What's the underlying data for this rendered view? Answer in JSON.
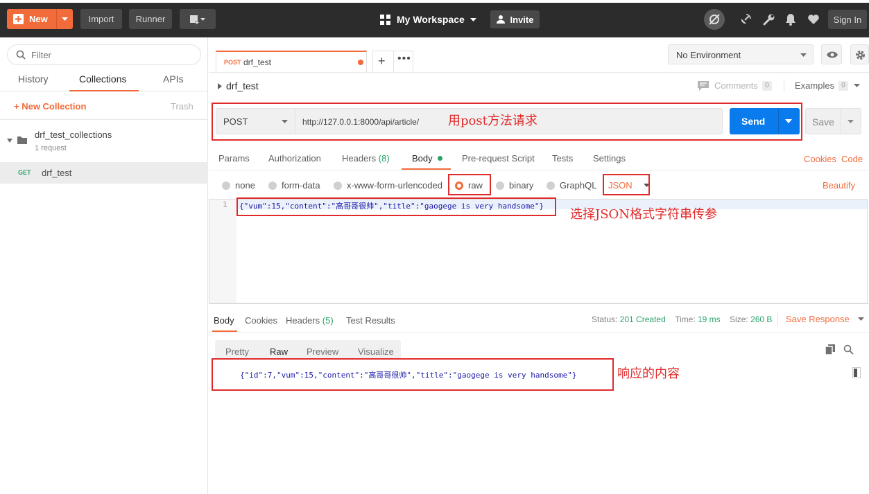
{
  "topbar": {
    "new_label": "New",
    "import_label": "Import",
    "runner_label": "Runner",
    "workspace_label": "My Workspace",
    "invite_label": "Invite",
    "signin_label": "Sign In"
  },
  "sidebar": {
    "filter_placeholder": "Filter",
    "tabs": [
      {
        "label": "History"
      },
      {
        "label": "Collections"
      },
      {
        "label": "APIs"
      }
    ],
    "new_collection_label": "+ New Collection",
    "trash_label": "Trash",
    "collection": {
      "name": "drf_test_collections",
      "meta": "1 request"
    },
    "request": {
      "method": "GET",
      "name": "drf_test"
    }
  },
  "tab": {
    "method": "POST",
    "name": "drf_test"
  },
  "environment": {
    "selected": "No Environment"
  },
  "breadcrumb": "drf_test",
  "comments": {
    "label": "Comments",
    "count": "0"
  },
  "examples": {
    "label": "Examples",
    "count": "0"
  },
  "request": {
    "method": "POST",
    "url": "http://127.0.0.1:8000/api/article/",
    "send_label": "Send",
    "save_label": "Save",
    "tabs": {
      "params": "Params",
      "authorization": "Authorization",
      "headers": "Headers",
      "headers_count": "(8)",
      "body": "Body",
      "prerequest": "Pre-request Script",
      "tests": "Tests",
      "settings": "Settings"
    },
    "cookies_label": "Cookies",
    "code_label": "Code",
    "body_types": {
      "none": "none",
      "form_data": "form-data",
      "urlencoded": "x-www-form-urlencoded",
      "raw": "raw",
      "binary": "binary",
      "graphql": "GraphQL"
    },
    "format": "JSON",
    "beautify_label": "Beautify",
    "line_number": "1",
    "body": "{\"vum\":15,\"content\":\"高哥哥很帅\",\"title\":\"gaogege is very handsome\"}"
  },
  "response": {
    "tabs": {
      "body": "Body",
      "cookies": "Cookies",
      "headers": "Headers",
      "headers_count": "(5)",
      "test_results": "Test Results"
    },
    "status_label": "Status:",
    "status_value": "201 Created",
    "time_label": "Time:",
    "time_value": "19 ms",
    "size_label": "Size:",
    "size_value": "260 B",
    "save_response_label": "Save Response",
    "view_tabs": {
      "pretty": "Pretty",
      "raw": "Raw",
      "preview": "Preview",
      "visualize": "Visualize"
    },
    "body": "{\"id\":7,\"vum\":15,\"content\":\"高哥哥很帅\",\"title\":\"gaogege is very handsome\"}"
  },
  "annotations": {
    "post_note": "用post方法请求",
    "json_note": "选择JSON格式字符串传参",
    "response_note": "响应的内容"
  },
  "colors": {
    "accent": "#f26b3a",
    "send_blue": "#097bed",
    "annotation_red": "#e02a2a",
    "status_green": "#2aa36a"
  }
}
